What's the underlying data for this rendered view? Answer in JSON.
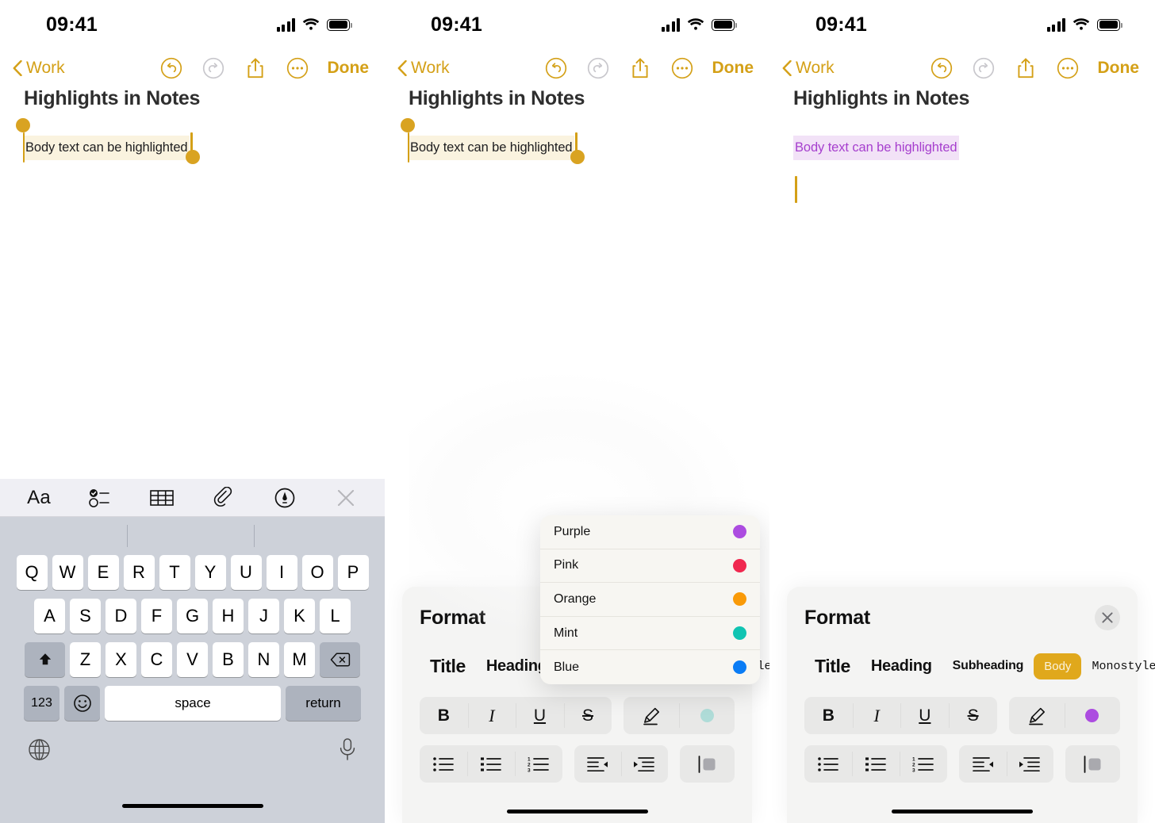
{
  "status": {
    "time": "09:41",
    "signal_icon": "cellular-signal-icon",
    "wifi_icon": "wifi-icon",
    "battery_icon": "battery-icon"
  },
  "nav": {
    "back_label": "Work",
    "done_label": "Done",
    "undo_icon": "undo-icon",
    "redo_icon": "redo-icon",
    "share_icon": "share-icon",
    "more_icon": "more-ellipsis-icon"
  },
  "note": {
    "title": "Highlights in Notes",
    "body_text": "Body text can be highlighted",
    "highlight_yellow": "#FAF3DF",
    "highlight_purple": "#F2E2F7",
    "purple_text_color": "#A63FCE",
    "accent": "#D4A017"
  },
  "keyboard": {
    "accessory": {
      "format_icon": "Aa",
      "checklist_icon": "checklist-icon",
      "table_icon": "table-icon",
      "attachment_icon": "paperclip-icon",
      "markup_icon": "markup-pen-icon",
      "close_icon": "close-icon"
    },
    "row1": [
      "Q",
      "W",
      "E",
      "R",
      "T",
      "Y",
      "U",
      "I",
      "O",
      "P"
    ],
    "row2": [
      "A",
      "S",
      "D",
      "F",
      "G",
      "H",
      "J",
      "K",
      "L"
    ],
    "row3": [
      "Z",
      "X",
      "C",
      "V",
      "B",
      "N",
      "M"
    ],
    "shift_icon": "shift-icon",
    "backspace_icon": "backspace-icon",
    "numbers_label": "123",
    "emoji_icon": "emoji-icon",
    "space_label": "space",
    "return_label": "return",
    "globe_icon": "globe-icon",
    "mic_icon": "microphone-icon"
  },
  "format": {
    "title": "Format",
    "close_icon": "close-icon",
    "styles": [
      {
        "label": "Title",
        "active": false
      },
      {
        "label": "Heading",
        "active": false
      },
      {
        "label": "Subheading",
        "active": false
      },
      {
        "label": "Body",
        "active": true
      },
      {
        "label": "Monostyled",
        "active": false
      }
    ],
    "text_styles": [
      {
        "label": "B",
        "name": "bold"
      },
      {
        "label": "I",
        "name": "italic"
      },
      {
        "label": "U",
        "name": "underline"
      },
      {
        "label": "S",
        "name": "strikethrough"
      }
    ],
    "highlight_pen_icon": "highlight-pen-icon",
    "highlight_color_selected": "#AC4CE0",
    "highlight_color_dimmed": "#AFDCD8",
    "lists": [
      "dashed-list-icon",
      "bulleted-list-icon",
      "numbered-list-icon"
    ],
    "align": [
      "outdent-icon",
      "indent-icon"
    ],
    "block": [
      "block-quote-icon"
    ],
    "active_style_bg": "#E0A81C"
  },
  "color_menu": {
    "items": [
      {
        "label": "Purple",
        "color": "#AC4CE0"
      },
      {
        "label": "Pink",
        "color": "#F0284F"
      },
      {
        "label": "Orange",
        "color": "#F99A08"
      },
      {
        "label": "Mint",
        "color": "#10C4B2"
      },
      {
        "label": "Blue",
        "color": "#0A7CF5"
      }
    ]
  }
}
